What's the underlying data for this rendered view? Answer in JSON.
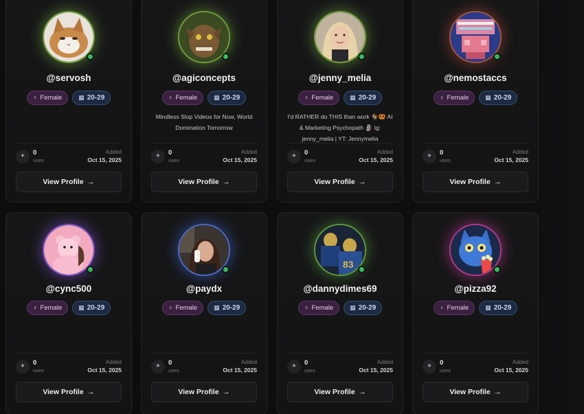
{
  "profiles": [
    {
      "username": "@servosh",
      "gender": "Female",
      "age": "20-29",
      "bio": "",
      "uses": "0",
      "uses_label": "uses",
      "added_label": "Added",
      "added_date": "Oct 15, 2025",
      "button": "View Profile",
      "glow": "#6f9f3a",
      "avatar_icon": "cat-avatar"
    },
    {
      "username": "@agiconcepts",
      "gender": "Female",
      "age": "20-29",
      "bio": "Mindless Slop Videos for Now, World Domination Tomorrow",
      "uses": "0",
      "uses_label": "uses",
      "added_label": "Added",
      "added_date": "Oct 15, 2025",
      "button": "View Profile",
      "glow": "#6f9f3a",
      "avatar_icon": "creature-avatar"
    },
    {
      "username": "@jenny_melia",
      "gender": "Female",
      "age": "20-29",
      "bio": "I'd RATHER do THIS than work 🐐🥨 AI & Marketing Psychopath 🗿 Ig: jenny_melia | YT: Jennymelia",
      "uses": "0",
      "uses_label": "uses",
      "added_label": "Added",
      "added_date": "Oct 15, 2025",
      "button": "View Profile",
      "glow": "#6f9f3a",
      "avatar_icon": "woman-avatar"
    },
    {
      "username": "@nemostaccs",
      "gender": "Female",
      "age": "20-29",
      "bio": "",
      "uses": "0",
      "uses_label": "uses",
      "added_label": "Added",
      "added_date": "Oct 15, 2025",
      "button": "View Profile",
      "glow": "#b04a3a",
      "avatar_icon": "pixel-avatar"
    },
    {
      "username": "@cync500",
      "gender": "Female",
      "age": "20-29",
      "bio": "",
      "uses": "0",
      "uses_label": "uses",
      "added_label": "Added",
      "added_date": "Oct 15, 2025",
      "button": "View Profile",
      "glow": "#7a52c8",
      "avatar_icon": "pink-bear-avatar"
    },
    {
      "username": "@paydx",
      "gender": "Female",
      "age": "20-29",
      "bio": "",
      "uses": "0",
      "uses_label": "uses",
      "added_label": "Added",
      "added_date": "Oct 15, 2025",
      "button": "View Profile",
      "glow": "#3d63c4",
      "avatar_icon": "phone-woman-avatar"
    },
    {
      "username": "@dannydimes69",
      "gender": "Female",
      "age": "20-29",
      "bio": "",
      "uses": "0",
      "uses_label": "uses",
      "added_label": "Added",
      "added_date": "Oct 15, 2025",
      "button": "View Profile",
      "glow": "#4f8f3a",
      "avatar_icon": "football-avatar"
    },
    {
      "username": "@pizza92",
      "gender": "Female",
      "age": "20-29",
      "bio": "",
      "uses": "0",
      "uses_label": "uses",
      "added_label": "Added",
      "added_date": "Oct 15, 2025",
      "button": "View Profile",
      "glow": "#b23a8a",
      "avatar_icon": "blue-cat-avatar"
    }
  ],
  "icons": {
    "gender": "gender-icon",
    "age": "calendar-icon",
    "uses": "sparkle-icon",
    "arrow": "arrow-right-icon"
  },
  "colors": {
    "online": "#35b85e",
    "gender_badge_bg": "#3a2140",
    "age_badge_bg": "#1d2a42"
  }
}
